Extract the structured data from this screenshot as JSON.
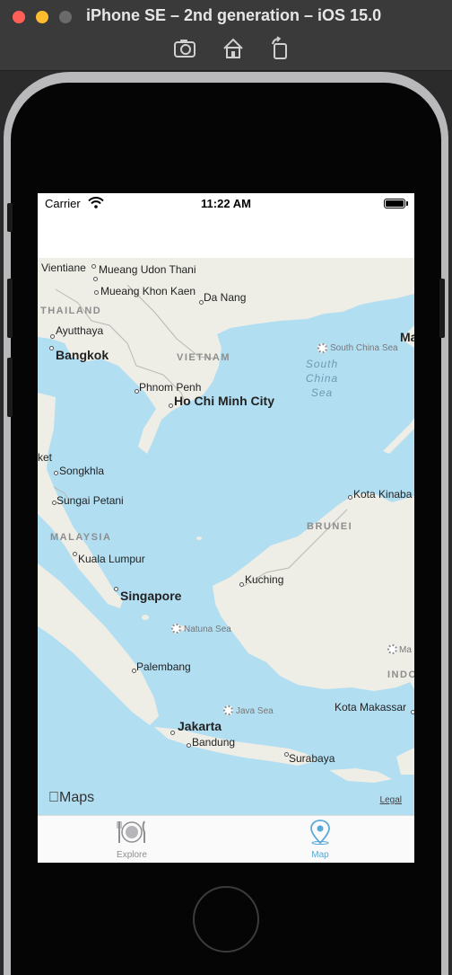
{
  "window": {
    "title": "iPhone SE – 2nd generation – iOS 15.0",
    "toolbar": [
      "screenshot-icon",
      "home-icon",
      "rotate-icon"
    ]
  },
  "status_bar": {
    "carrier": "Carrier",
    "time": "11:22 AM",
    "battery_level": 1.0
  },
  "map": {
    "cities": [
      {
        "name": "Vientiane",
        "style": "small"
      },
      {
        "name": "Mueang Udon Thani",
        "style": "small"
      },
      {
        "name": "Mueang Khon Kaen",
        "style": "small"
      },
      {
        "name": "Da Nang",
        "style": "small"
      },
      {
        "name": "Ayutthaya",
        "style": "small"
      },
      {
        "name": "Bangkok",
        "style": "bold"
      },
      {
        "name": "Phnom Penh",
        "style": "small"
      },
      {
        "name": "Ho Chi Minh City",
        "style": "bold"
      },
      {
        "name": "Songkhla",
        "style": "small"
      },
      {
        "name": "Sungai Petani",
        "style": "small"
      },
      {
        "name": "Kuala Lumpur",
        "style": "small"
      },
      {
        "name": "Singapore",
        "style": "bold"
      },
      {
        "name": "Kuching",
        "style": "small"
      },
      {
        "name": "Kota Kinaba",
        "style": "small"
      },
      {
        "name": "Palembang",
        "style": "small"
      },
      {
        "name": "Jakarta",
        "style": "bold"
      },
      {
        "name": "Bandung",
        "style": "small"
      },
      {
        "name": "Surabaya",
        "style": "small"
      },
      {
        "name": "Kota Makassar",
        "style": "small"
      },
      {
        "name": "ket",
        "style": "small"
      },
      {
        "name": "Ma",
        "style": "bold"
      }
    ],
    "countries": [
      "THAILAND",
      "VIETNAM",
      "MALAYSIA",
      "BRUNEI",
      "INDO"
    ],
    "seas": [
      "South China Sea",
      "Natuna Sea",
      "Java Sea",
      "Ma"
    ],
    "sea_region_label": [
      "South",
      "China",
      "Sea"
    ],
    "attribution": "Maps",
    "legal": "Legal",
    "colors": {
      "water": "#b2def2",
      "land": "#eeeee6",
      "border": "#b7b7b7"
    }
  },
  "tabs": [
    {
      "label": "Explore",
      "icon": "plate-utensils-icon",
      "selected": false,
      "color": "#8e8e93"
    },
    {
      "label": "Map",
      "icon": "map-pin-icon",
      "selected": true,
      "color": "#5aa9d6"
    }
  ]
}
